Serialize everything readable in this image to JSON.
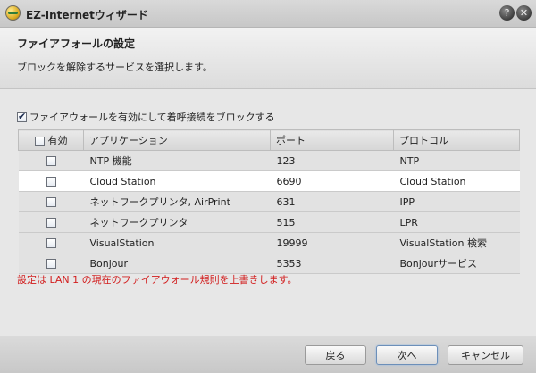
{
  "window": {
    "title": "EZ-Internetウィザード"
  },
  "header": {
    "title": "ファイアフォールの設定",
    "subtitle": "ブロックを解除するサービスを選択します。"
  },
  "firewall_toggle": {
    "label": "ファイアウォールを有効にして着呼接続をブロックする",
    "checked": true
  },
  "table": {
    "columns": [
      "有効",
      "アプリケーション",
      "ポート",
      "プロトコル"
    ],
    "rows": [
      {
        "enabled": false,
        "application": "NTP 機能",
        "port": "123",
        "protocol": "NTP"
      },
      {
        "enabled": false,
        "application": "Cloud Station",
        "port": "6690",
        "protocol": "Cloud Station",
        "selected": true
      },
      {
        "enabled": false,
        "application": "ネットワークプリンタ, AirPrint",
        "port": "631",
        "protocol": "IPP"
      },
      {
        "enabled": false,
        "application": "ネットワークプリンタ",
        "port": "515",
        "protocol": "LPR"
      },
      {
        "enabled": false,
        "application": "VisualStation",
        "port": "19999",
        "protocol": "VisualStation 検索"
      },
      {
        "enabled": false,
        "application": "Bonjour",
        "port": "5353",
        "protocol": "Bonjourサービス"
      }
    ]
  },
  "note": "設定は LAN 1 の現在のファイアウォール規則を上書きします。",
  "buttons": {
    "back": "戻る",
    "next": "次へ",
    "cancel": "キャンセル"
  },
  "icons": {
    "app": "wizard-app-icon",
    "help": "help-icon",
    "close": "close-icon"
  },
  "colors": {
    "note": "#d21e1e",
    "selected_row": "#ffffff",
    "row_bg": "#e2e2e2"
  }
}
